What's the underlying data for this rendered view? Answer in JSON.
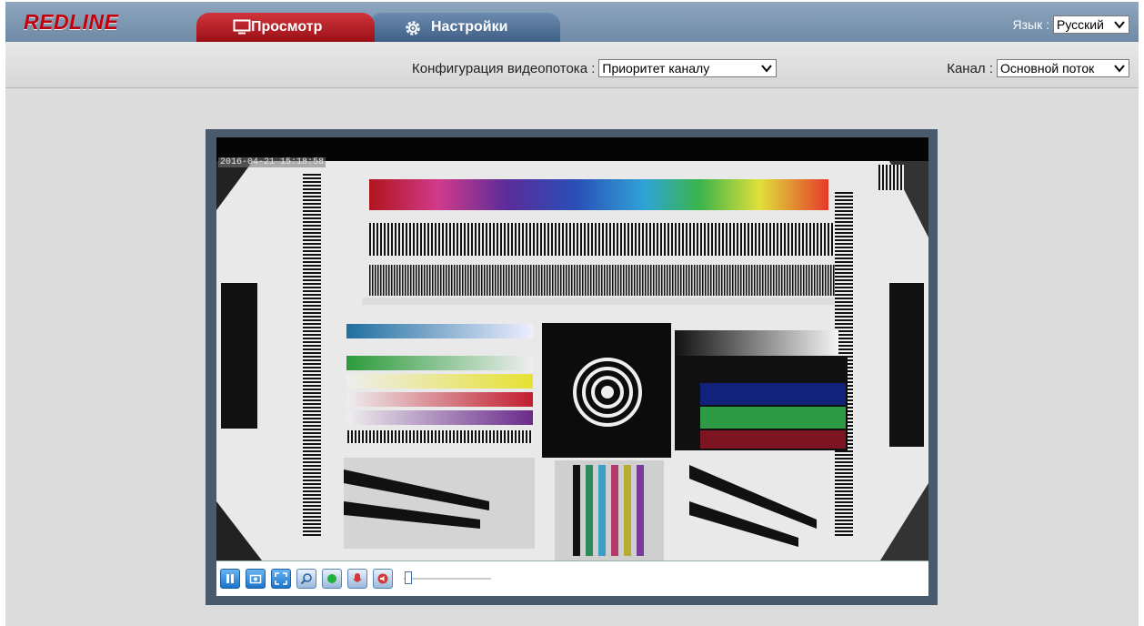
{
  "header": {
    "logo_text": "REDLINE",
    "tabs": [
      {
        "label": "Просмотр",
        "icon": "monitor-icon",
        "active": true
      },
      {
        "label": "Настройки",
        "icon": "gear-icon",
        "active": false
      }
    ],
    "language_label": "Язык :",
    "language_value": "Русский"
  },
  "config": {
    "stream_label": "Конфигурация видеопотока :",
    "stream_value": "Приоритет каналу",
    "channel_label": "Канал :",
    "channel_value": "Основной поток"
  },
  "video": {
    "timestamp": "2016-04-21 15:18:58"
  },
  "controls": {
    "buttons": [
      "pause-icon",
      "snapshot-icon",
      "fullscreen-icon",
      "zoom-icon",
      "record-icon",
      "microphone-icon",
      "speaker-icon"
    ],
    "volume_level": 0.05
  },
  "colors": {
    "active_tab": "#b81f26",
    "inactive_tab": "#4f6f94",
    "header_bg": "#7f98b3",
    "logo": "#c0000c"
  }
}
